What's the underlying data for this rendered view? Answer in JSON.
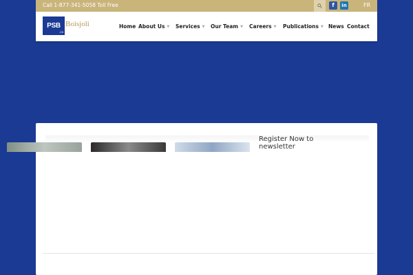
{
  "topbar": {
    "phone": "Call 1-877-341-5058 Toll Free",
    "language": "FR"
  },
  "logo": {
    "mark": "PSB",
    "name": "Boisjoli",
    "suffix": ".ca"
  },
  "nav": {
    "items": [
      {
        "label": "Home"
      },
      {
        "label": "About Us"
      },
      {
        "label": "Services"
      },
      {
        "label": "Our Team"
      },
      {
        "label": "Careers"
      },
      {
        "label": "Publications"
      },
      {
        "label": "News"
      },
      {
        "label": "Contact"
      }
    ]
  },
  "newsletter": {
    "line1": "Register Now to",
    "line2": "newsletter"
  },
  "colors": {
    "background": "#1b3a94",
    "topbar": "#c9b47a",
    "brand_gold": "#b39a55"
  },
  "icons": [
    "search-icon",
    "facebook-icon",
    "linkedin-icon",
    "chevron-down-icon"
  ]
}
